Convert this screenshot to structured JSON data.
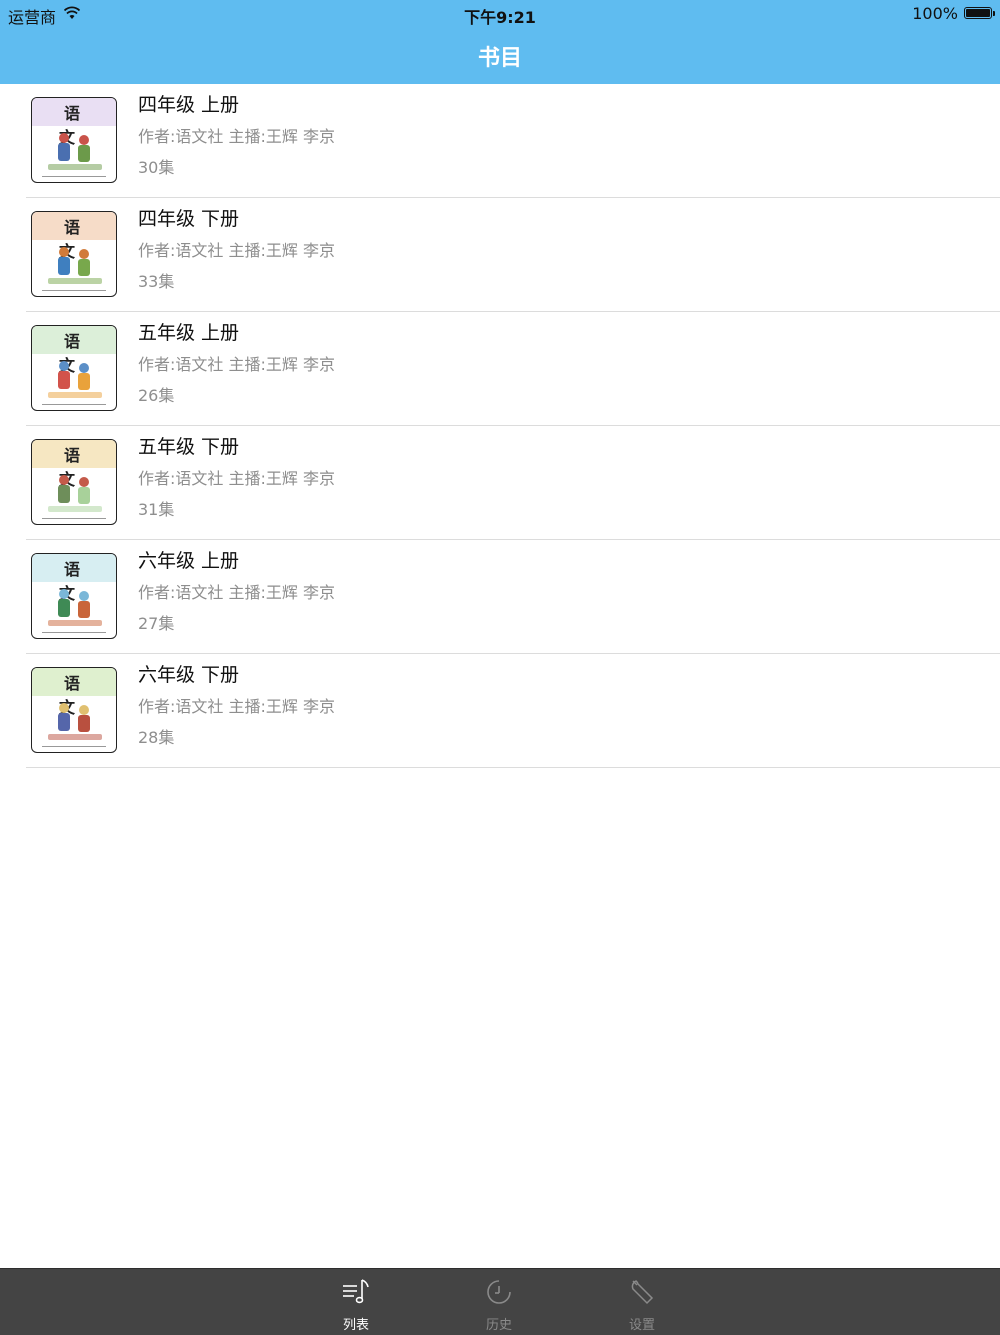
{
  "status_bar": {
    "carrier": "运营商",
    "time": "下午9:21",
    "battery": "100%"
  },
  "nav": {
    "title": "书目"
  },
  "books": [
    {
      "title": "四年级 上册",
      "meta": "作者:语文社  主播:王辉 李京",
      "count": "30集",
      "band_color": "#e9dff3"
    },
    {
      "title": "四年级 下册",
      "meta": "作者:语文社  主播:王辉 李京",
      "count": "33集",
      "band_color": "#f6dcc8"
    },
    {
      "title": "五年级 上册",
      "meta": "作者:语文社  主播:王辉 李京",
      "count": "26集",
      "band_color": "#dcefd9"
    },
    {
      "title": "五年级 下册",
      "meta": "作者:语文社  主播:王辉 李京",
      "count": "31集",
      "band_color": "#f6e7c2"
    },
    {
      "title": "六年级 上册",
      "meta": "作者:语文社  主播:王辉 李京",
      "count": "27集",
      "band_color": "#d7eef2"
    },
    {
      "title": "六年级 下册",
      "meta": "作者:语文社  主播:王辉 李京",
      "count": "28集",
      "band_color": "#dff0cf"
    }
  ],
  "cover_label": "语 文",
  "tabs": [
    {
      "label": "列表",
      "icon": "music-list-icon",
      "active": true
    },
    {
      "label": "历史",
      "icon": "clock-icon",
      "active": false
    },
    {
      "label": "设置",
      "icon": "wrench-icon",
      "active": false
    }
  ],
  "colors": {
    "nav_bar": "#5fbcf0",
    "tab_bar": "#444444"
  }
}
